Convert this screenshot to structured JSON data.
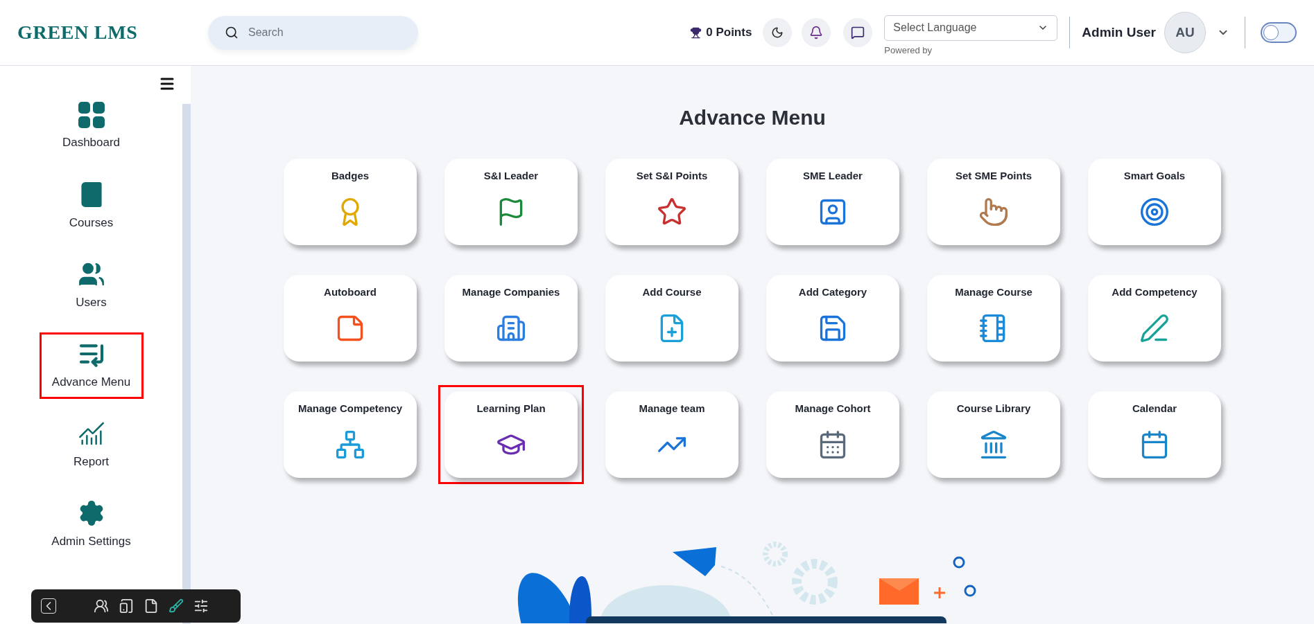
{
  "header": {
    "logo": "GREEN LMS",
    "search": {
      "placeholder": "Search"
    },
    "points": "0 Points",
    "language_select": {
      "value": "Select Language",
      "note": "Powered by"
    },
    "user": {
      "name": "Admin User",
      "initials": "AU"
    },
    "theme_toggle": {
      "on": false
    }
  },
  "sidebar": {
    "items": [
      {
        "label": "Dashboard",
        "selected": false
      },
      {
        "label": "Courses",
        "selected": false
      },
      {
        "label": "Users",
        "selected": false
      },
      {
        "label": "Advance Menu",
        "selected": true
      },
      {
        "label": "Report",
        "selected": false
      },
      {
        "label": "Admin Settings",
        "selected": false
      }
    ]
  },
  "page": {
    "title": "Advance Menu",
    "cards": [
      {
        "label": "Badges",
        "highlighted": false
      },
      {
        "label": "S&I Leader",
        "highlighted": false
      },
      {
        "label": "Set S&I Points",
        "highlighted": false
      },
      {
        "label": "SME Leader",
        "highlighted": false
      },
      {
        "label": "Set SME Points",
        "highlighted": false
      },
      {
        "label": "Smart Goals",
        "highlighted": false
      },
      {
        "label": "Autoboard",
        "highlighted": false
      },
      {
        "label": "Manage Companies",
        "highlighted": false
      },
      {
        "label": "Add Course",
        "highlighted": false
      },
      {
        "label": "Add Category",
        "highlighted": false
      },
      {
        "label": "Manage Course",
        "highlighted": false
      },
      {
        "label": "Add Competency",
        "highlighted": false
      },
      {
        "label": "Manage Competency",
        "highlighted": false
      },
      {
        "label": "Learning Plan",
        "highlighted": true
      },
      {
        "label": "Manage team",
        "highlighted": false
      },
      {
        "label": "Manage Cohort",
        "highlighted": false
      },
      {
        "label": "Course Library",
        "highlighted": false
      },
      {
        "label": "Calendar",
        "highlighted": false
      }
    ]
  }
}
